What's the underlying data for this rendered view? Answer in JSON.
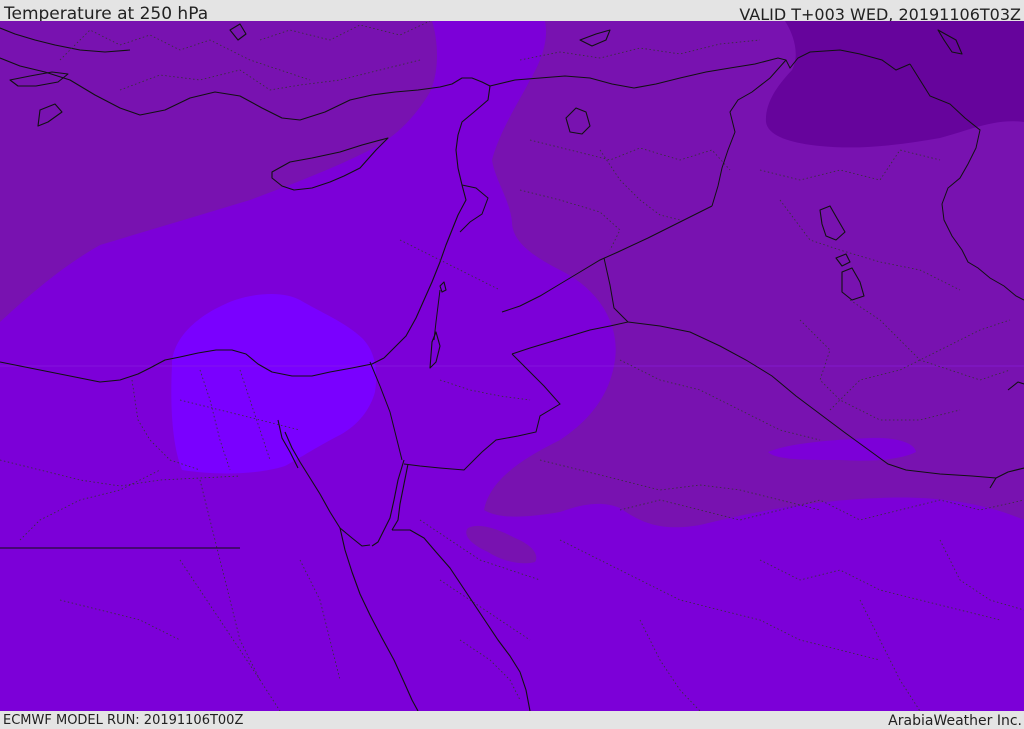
{
  "header": {
    "title": "Temperature at 250 hPa",
    "valid_time": "VALID T+003 WED, 20191106T03Z"
  },
  "footer": {
    "model_run": "ECMWF MODEL RUN: 20191106T00Z",
    "credit": "ArabiaWeather Inc."
  },
  "map": {
    "colors": {
      "base": "#7c00d8",
      "cooler": "#7812b0",
      "coldest": "#66049c",
      "warmest": "#7a00ff",
      "coast": "#111111",
      "admin": "#333333"
    }
  }
}
